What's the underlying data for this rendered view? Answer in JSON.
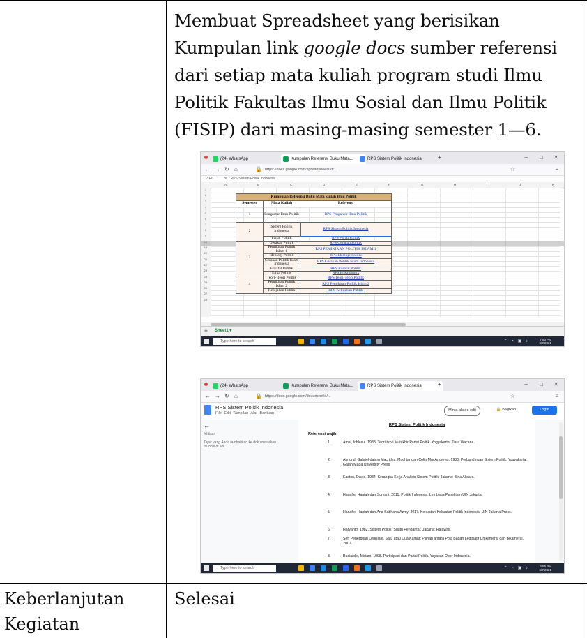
{
  "description": {
    "line1": "Membuat Spreadsheet yang berisikan",
    "line2_a": "Kumpulan link ",
    "line2_i": "google docs",
    "line2_b": " sumber referensi",
    "line3": "dari setiap mata kuliah program studi Ilmu",
    "line4": "Politik Fakultas Ilmu Sosial dan Ilmu Politik",
    "line5": "(FISIP) dari masing-masing semester 1—6."
  },
  "bottom_row": {
    "label_line1": "Keberlanjutan",
    "label_line2": "Kegiatan",
    "value": "Selesai"
  },
  "sheet_screenshot": {
    "tabs": [
      "(24) WhatsApp",
      "Kumpulan Referensi Buku Mata...",
      "RPS Sistem Politik Indonesia"
    ],
    "url": "https://docs.google.com/spreadsheets/d/...",
    "cell_ref": "C7:E6",
    "formula": "RPS Sistem Politik Indonesia",
    "columns": [
      "A",
      "B",
      "C",
      "D",
      "E",
      "F",
      "G",
      "H",
      "I",
      "J",
      "K"
    ],
    "rows": [
      "1",
      "2",
      "3",
      "4",
      "5",
      "6",
      "7",
      "8",
      "9",
      "18",
      "19",
      "20",
      "21",
      "22",
      "23",
      "24",
      "25",
      "26",
      "27",
      "28"
    ],
    "table_title": "Kumpulan Referensi Buku Mata kuliah Ilmu Politik",
    "headers": [
      "Semester",
      "Mata Kuliah",
      "Referensi"
    ],
    "entries": [
      {
        "semester": "1",
        "course": "Pengantar Ilmu Politik",
        "ref": "RPS Pengantar Ilmu Politik"
      },
      {
        "semester": "2",
        "course": "Sistem Politik Indonesia",
        "ref": "RPS Sistem Politik Indonesia"
      },
      {
        "semester": "",
        "course": "Partai Politik",
        "ref": "RPS Partai Politik"
      },
      {
        "semester": "",
        "course": "Gerakan Politik",
        "ref": "RPS Gerakan Politik"
      },
      {
        "semester": "",
        "course": "Pemikiran Politik Islam 1",
        "ref": "RPS PEMIKIRAN POLITIK ISLAM 1"
      },
      {
        "semester": "3",
        "course": "Ideologi Politik",
        "ref": "RPS Ideologi Politik"
      },
      {
        "semester": "",
        "course": "Gerakan Politik Islam Indonesia",
        "ref": "RPS Gerakan Politik Islam Indonesia"
      },
      {
        "semester": "",
        "course": "Filsafat Politik",
        "ref": "RPS Filsafat Politik"
      },
      {
        "semester": "",
        "course": "Etika Politik",
        "ref": "RPS Etika politik"
      },
      {
        "semester": "",
        "course": "Teori- Teori Politik",
        "ref": "RPS Teori-Teori Politik"
      },
      {
        "semester": "4",
        "course": "Pemikiran Politik Islam 2",
        "ref": "RPS Pemikiran Politik Islam 2"
      },
      {
        "semester": "",
        "course": "Kebijakan Publik",
        "ref": "RPS Kebijakan Publik"
      }
    ],
    "sheet_tab": "Sheet1",
    "search_placeholder": "Type here to search",
    "clock_time": "7:50 PM",
    "clock_date": "6/7/2021"
  },
  "doc_screenshot": {
    "tabs": [
      "(24) WhatsApp",
      "Kumpulan Referensi Buku Mata...",
      "RPS Sistem Politik Indonesia"
    ],
    "url": "https://docs.google.com/document/d/...",
    "title": "RPS Sistem Politik Indonesia",
    "menu": "File Edit Tampilan Alat Bantuan",
    "request_button": "Minta akses edit",
    "share_button": "Bagikan",
    "login_button": "Login",
    "outline_heading": "Ikhtisar",
    "outline_hint": "Tajuk yang Anda tambahkan ke dokumen akan muncul di sini.",
    "doc_heading": "RPS Sistem Politik Indonesia",
    "ref_heading": "Referensi wajib:",
    "references": [
      {
        "n": "1.",
        "text": "Amal, Ichlasul. 1988. Teori-teori Mutakhir Partai Politik. Yogyakarta: Tiara Wacana."
      },
      {
        "n": "2.",
        "text": "Almond, Gabriel dalam Macrides, Mochtar dan Colin MacAndrews. 1980. Perbandingan Sistem Politik. Yogyakarta: Gajah Mada University Press."
      },
      {
        "n": "3.",
        "text": "Easton, David. 1984. Kerangka Kerja Analisis Sistem Politik. Jakarta: Bina Aksara."
      },
      {
        "n": "4.",
        "text": "Hanafie, Haniah dan Suryani. 2011. Politik Indonesia. Lembaga Penelitian UIN Jakarta."
      },
      {
        "n": "5.",
        "text": "Hanafie, Haniah dan Ana Sabhana Azmy. 2017. Kekuatan-Kekuatan Politik Indonesia. UIN Jakarta Press."
      },
      {
        "n": "6.",
        "text": "Haryanto. 1982. Sistem Politik: Suatu Pengantar. Jakarta: Rajawali."
      },
      {
        "n": "7.",
        "text": "Seri Penerbitan Legislatif. Satu atau Dua Kamar: Pilihan antara Pola Badan Legislatif Unikameral dan Bikameral. 2001."
      },
      {
        "n": "8.",
        "text": "Budiardjo, Miriam. 1998. Partisipasi dan Partai Politik. Yayasan Obor Indonesia."
      }
    ],
    "search_placeholder": "Type here to search",
    "clock_time": "3:56 PM",
    "clock_date": "6/7/2021"
  }
}
